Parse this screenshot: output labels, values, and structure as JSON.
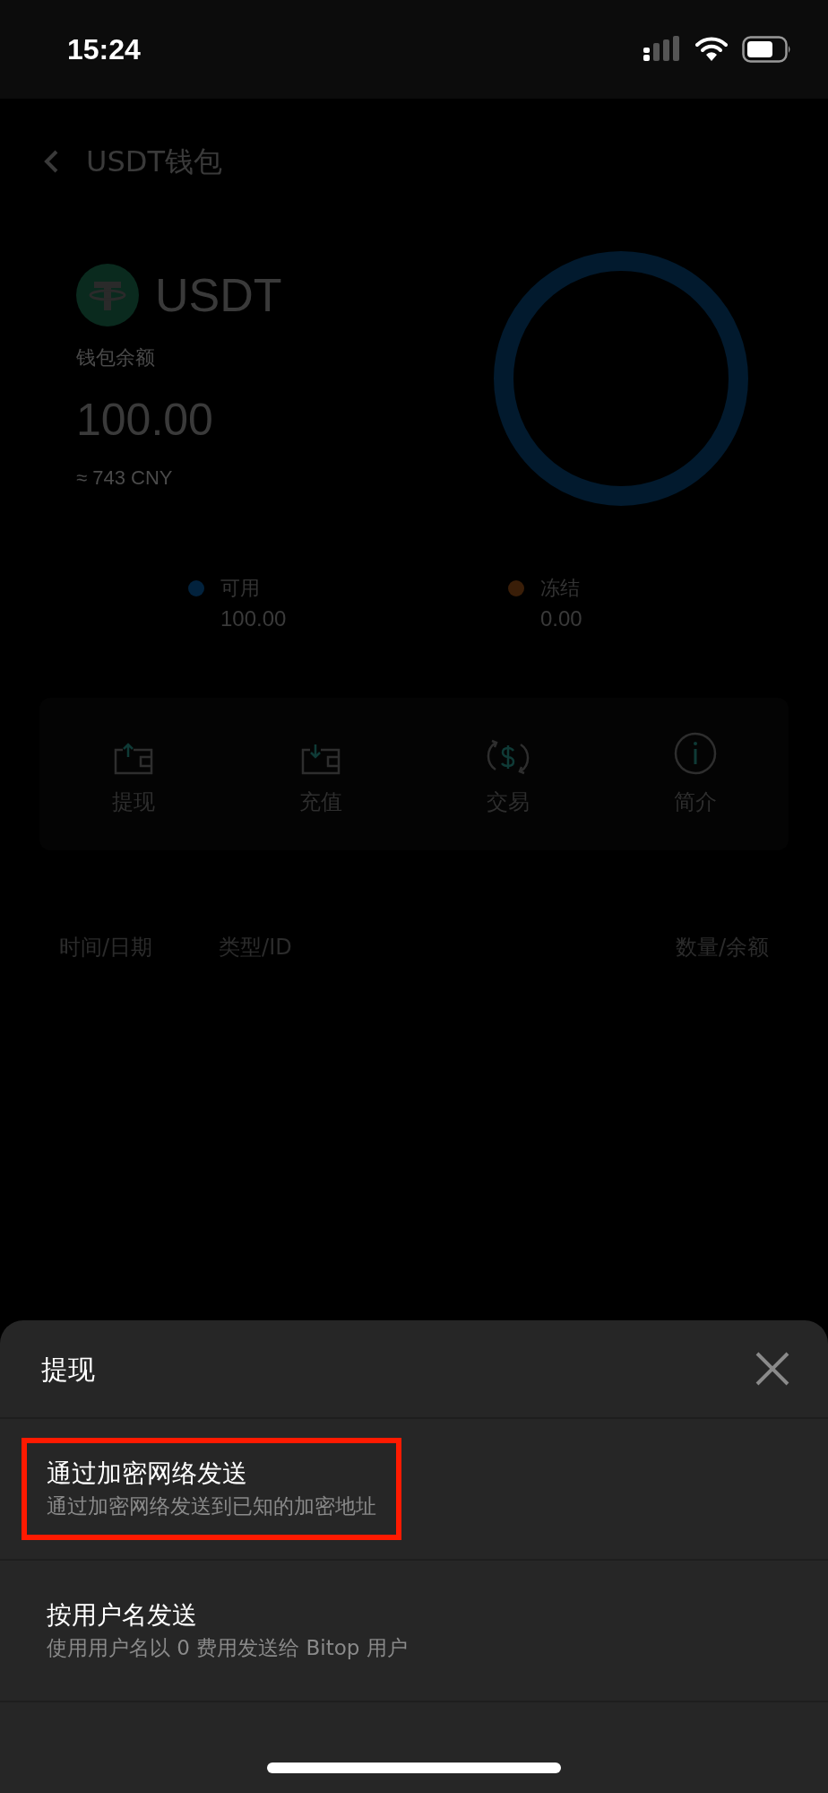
{
  "status_bar": {
    "time": "15:24"
  },
  "header": {
    "title": "USDT钱包"
  },
  "coin": {
    "symbol": "USDT",
    "balance_label": "钱包余额",
    "balance": "100.00",
    "fiat": "≈ 743 CNY"
  },
  "legend": [
    {
      "label": "可用",
      "value": "100.00",
      "color": "#02223d"
    },
    {
      "label": "冻结",
      "value": "0.00",
      "color": "#3a1e08"
    }
  ],
  "actions": [
    {
      "kind": "withdraw",
      "label": "提现"
    },
    {
      "kind": "deposit",
      "label": "充值"
    },
    {
      "kind": "trade",
      "label": "交易"
    },
    {
      "kind": "info",
      "label": "简介"
    }
  ],
  "table": {
    "columns": [
      "时间/日期",
      "类型/ID",
      "数量/余额"
    ]
  },
  "sheet": {
    "title": "提现",
    "options": [
      {
        "title": "通过加密网络发送",
        "subtitle": "通过加密网络发送到已知的加密地址",
        "highlighted": true
      },
      {
        "title": "按用户名发送",
        "subtitle": "使用用户名以 0 费用发送给 Bitop 用户",
        "highlighted": false
      }
    ]
  }
}
